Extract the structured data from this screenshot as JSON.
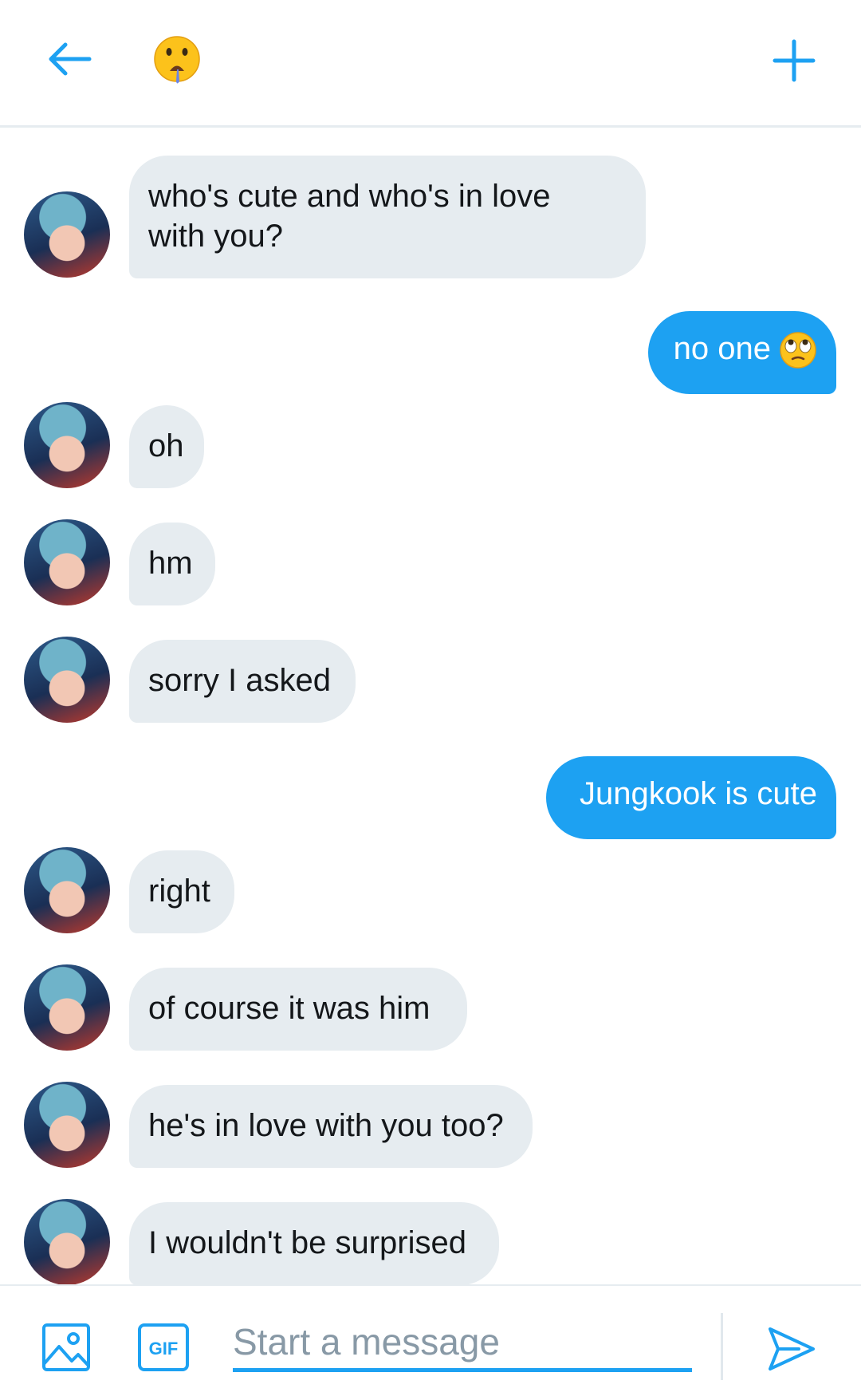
{
  "header": {
    "back_icon": "arrow-left-icon",
    "title_emoji": "drooling-face-emoji",
    "add_icon": "plus-icon"
  },
  "colors": {
    "accent": "#1da1f2",
    "received_bubble": "#e6ecf0",
    "received_text": "#14171a",
    "sent_text": "#ffffff",
    "placeholder": "#8899a6"
  },
  "messages": [
    {
      "sender": "them",
      "text": "who's cute and who's in love\nwith you?"
    },
    {
      "sender": "me",
      "text": "no one",
      "emoji": "face-with-rolling-eyes"
    },
    {
      "sender": "them",
      "text": "oh"
    },
    {
      "sender": "them",
      "text": "hm"
    },
    {
      "sender": "them",
      "text": "sorry I asked"
    },
    {
      "sender": "me",
      "text": "Jungkook is cute"
    },
    {
      "sender": "them",
      "text": "right"
    },
    {
      "sender": "them",
      "text": "of course it was him"
    },
    {
      "sender": "them",
      "text": "he's in love with you too?"
    },
    {
      "sender": "them",
      "text": "I wouldn't be surprised"
    }
  ],
  "composer": {
    "image_icon": "image-icon",
    "gif_label": "GIF",
    "placeholder": "Start a message",
    "value": "",
    "send_icon": "send-icon"
  }
}
